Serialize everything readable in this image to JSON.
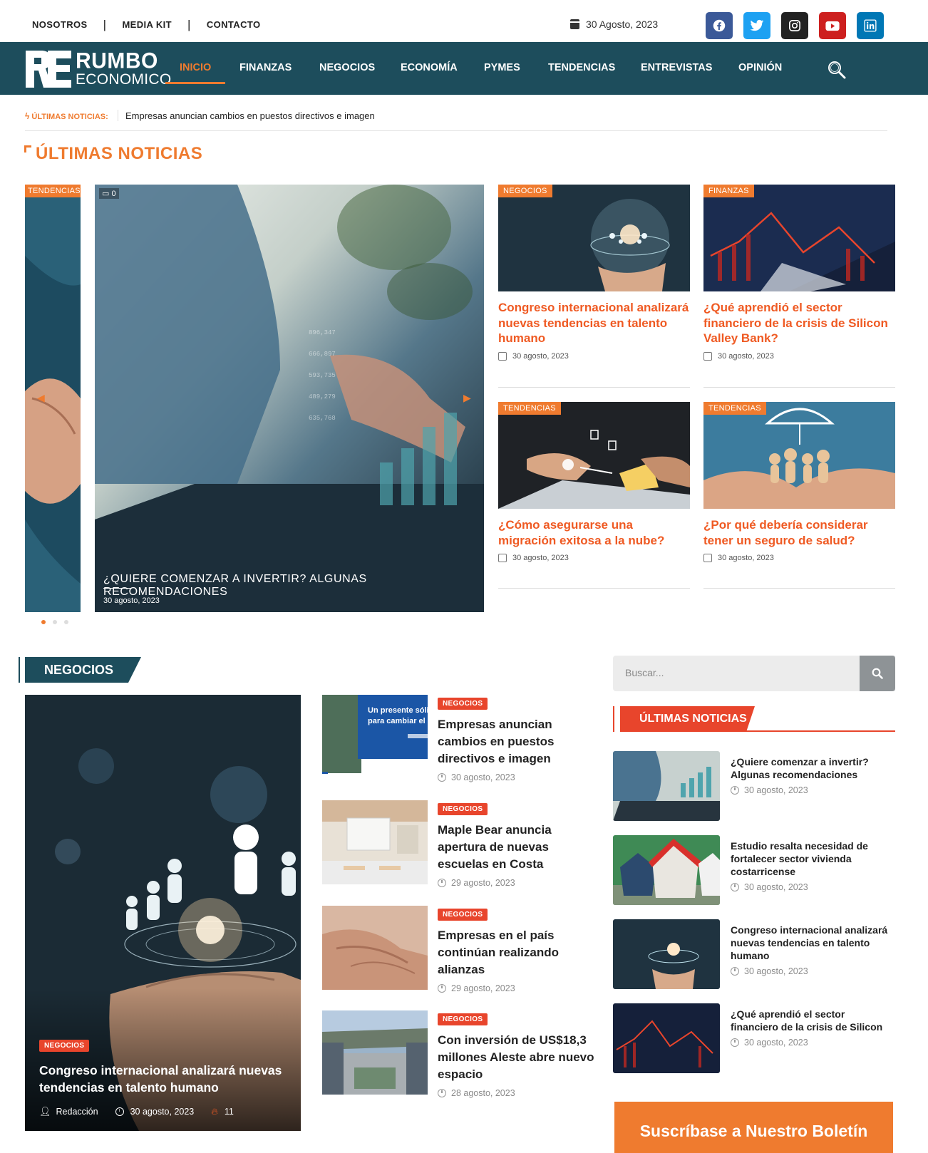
{
  "topbar": {
    "links": [
      "NOSOTROS",
      "MEDIA KIT",
      "CONTACTO"
    ],
    "separator": "|",
    "date": "30 Agosto, 2023",
    "social": [
      {
        "name": "facebook-icon",
        "glyph": "f",
        "color": "#3b5998"
      },
      {
        "name": "twitter-icon",
        "glyph": "t",
        "color": "#1da1f2"
      },
      {
        "name": "instagram-icon",
        "glyph": "◎",
        "color": "#222222"
      },
      {
        "name": "youtube-icon",
        "glyph": "▶",
        "color": "#cd201f"
      },
      {
        "name": "linkedin-icon",
        "glyph": "in",
        "color": "#0077b5"
      }
    ]
  },
  "logo": {
    "re": "RE",
    "rumbo": "RUMBO",
    "economico": "ECONOMICO"
  },
  "nav": {
    "items": [
      "INICIO",
      "FINANZAS",
      "NEGOCIOS",
      "ECONOMÍA",
      "PYMES",
      "TENDENCIAS",
      "ENTREVISTAS",
      "OPINIÓN"
    ],
    "active_index": 0
  },
  "ticker": {
    "label": "ÚLTIMAS NOTICIAS:",
    "text": "Empresas anuncian cambios en puestos directivos e imagen"
  },
  "latest_section": {
    "title": "ÚLTIMAS NOTICIAS"
  },
  "slider": {
    "prev_tag": "TENDENCIAS",
    "comments": "0",
    "caption": "¿QUIERE COMENZAR A INVERTIR? ALGUNAS RECOMENDACIONES",
    "date": "30 agosto, 2023"
  },
  "cards": [
    {
      "tag": "NEGOCIOS",
      "title": "Congreso internacional analizará nuevas tendencias en talento humano",
      "date": "30 agosto, 2023"
    },
    {
      "tag": "FINANZAS",
      "title": "¿Qué aprendió el sector financiero de la crisis de Silicon Valley Bank?",
      "date": "30 agosto, 2023"
    },
    {
      "tag": "TENDENCIAS",
      "title": "¿Cómo asegurarse una migración exitosa a la nube?",
      "date": "30 agosto, 2023"
    },
    {
      "tag": "TENDENCIAS",
      "title": "¿Por qué debería considerar tener un seguro de salud?",
      "date": "30 agosto, 2023"
    }
  ],
  "negocios": {
    "header": "NEGOCIOS",
    "featured": {
      "tag": "NEGOCIOS",
      "title": "Congreso internacional analizará nuevas tendencias en talento humano",
      "author": "Redacción",
      "date": "30 agosto, 2023",
      "views": "11"
    },
    "items": [
      {
        "tag": "NEGOCIOS",
        "title": "Empresas anuncian cambios en puestos directivos e imagen",
        "date": "30 agosto, 2023",
        "thumb_text": "Un presente sólido para cambiar el"
      },
      {
        "tag": "NEGOCIOS",
        "title": "Maple Bear anuncia apertura de nuevas escuelas en Costa",
        "date": "29 agosto, 2023"
      },
      {
        "tag": "NEGOCIOS",
        "title": "Empresas en el país continúan realizando alianzas",
        "date": "29 agosto, 2023"
      },
      {
        "tag": "NEGOCIOS",
        "title": "Con inversión de US$18,3 millones Aleste abre nuevo espacio",
        "date": "28 agosto, 2023"
      }
    ]
  },
  "sidebar": {
    "search_placeholder": "Buscar...",
    "title": "ÚLTIMAS NOTICIAS",
    "items": [
      {
        "title": "¿Quiere comenzar a invertir? Algunas recomendaciones",
        "date": "30 agosto, 2023"
      },
      {
        "title": "Estudio resalta necesidad de fortalecer sector vivienda costarricense",
        "date": "30 agosto, 2023"
      },
      {
        "title": "Congreso internacional analizará nuevas tendencias en talento humano",
        "date": "30 agosto, 2023"
      },
      {
        "title": "¿Qué aprendió el sector financiero de la crisis de Silicon",
        "date": "30 agosto, 2023"
      }
    ],
    "newsletter": "Suscríbase a Nuestro Boletín"
  },
  "colors": {
    "accent": "#ef7b2f",
    "accent_red": "#e8452c",
    "nav_bg": "#1d4d5c"
  }
}
